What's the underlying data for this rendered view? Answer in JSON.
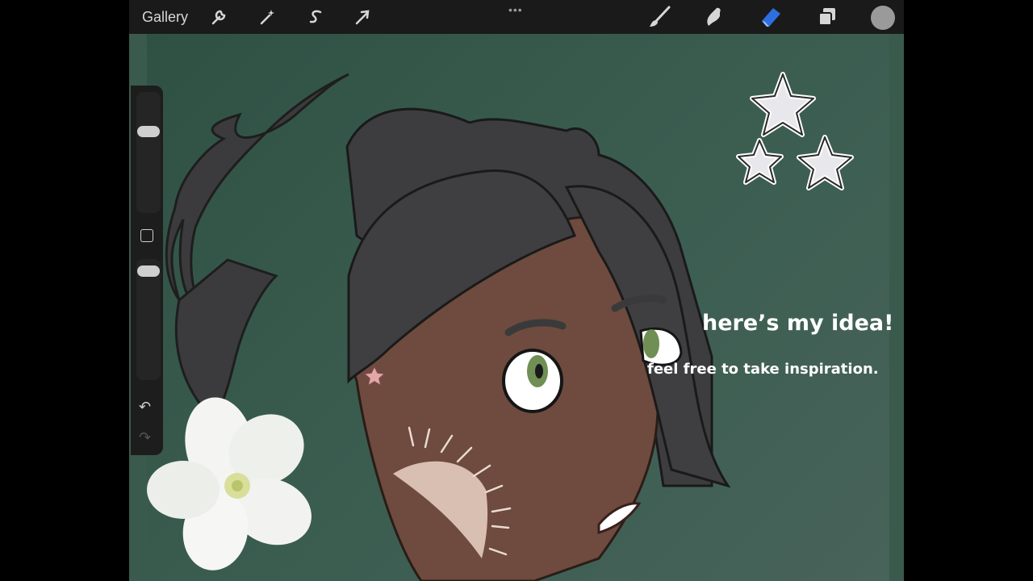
{
  "toolbar": {
    "gallery_label": "Gallery",
    "icons": [
      "wrench-icon",
      "magic-wand-icon",
      "selection-s-icon",
      "transform-arrow-icon",
      "brush-icon",
      "smudge-icon",
      "eraser-icon",
      "layers-icon",
      "color-swatch"
    ],
    "more": "•••",
    "active_tool_color": "#2d6fe0"
  },
  "sidebar": {
    "undo": "↶",
    "redo": "↷"
  },
  "canvas": {
    "caption_title": "here’s my idea!",
    "caption_body": "feel free to take inspiration.",
    "background_color": "#3a5a4d"
  }
}
